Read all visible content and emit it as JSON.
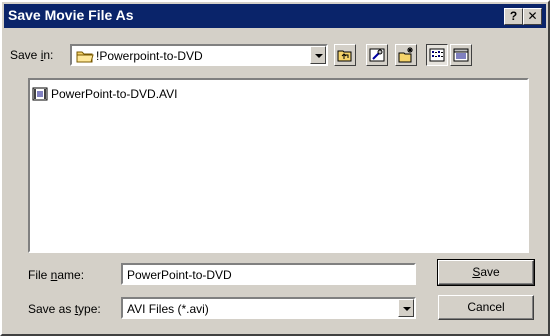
{
  "window": {
    "title": "Save Movie File As",
    "help_button": "?",
    "close_button": "✕"
  },
  "toolbar": {
    "save_in_label_pre": "Save ",
    "save_in_label_ul": "i",
    "save_in_label_post": "n:",
    "folder": "!Powerpoint-to-DVD",
    "buttons": [
      "up-one-level",
      "desktop",
      "create-new-folder",
      "list-view",
      "details-view"
    ]
  },
  "files": [
    {
      "name": "PowerPoint-to-DVD.AVI",
      "icon": "avi-file-icon"
    }
  ],
  "form": {
    "filename_label_pre": "File ",
    "filename_label_ul": "n",
    "filename_label_post": "ame:",
    "filename_value": "PowerPoint-to-DVD",
    "type_label_pre": "Save as ",
    "type_label_ul": "t",
    "type_label_post": "ype:",
    "type_value": "AVI Files (*.avi)"
  },
  "actions": {
    "save_ul": "S",
    "save_rest": "ave",
    "cancel": "Cancel"
  }
}
